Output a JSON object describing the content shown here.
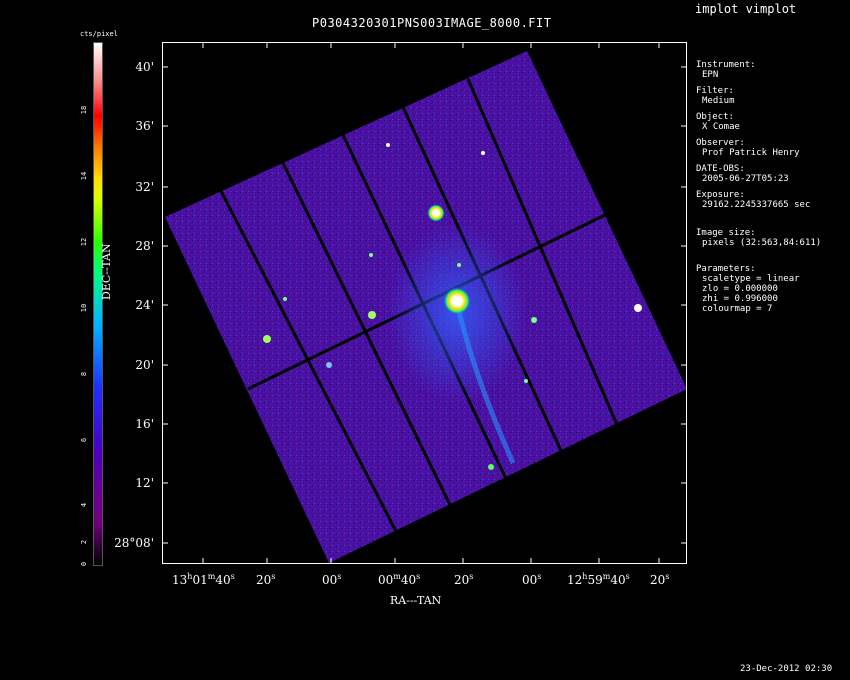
{
  "app_title": "implot vimplot",
  "plot_title": "P0304320301PNS003IMAGE_8000.FIT",
  "colorbar": {
    "label": "cts/pixel",
    "ticks": [
      "18",
      "14",
      "12",
      "10",
      "8",
      "6",
      "4",
      "2",
      "0"
    ]
  },
  "axes": {
    "ylabel": "DEC--TAN",
    "xlabel": "RA---TAN",
    "dec_ticks": [
      "40'",
      "36'",
      "32'",
      "28'",
      "24'",
      "20'",
      "16'",
      "12'",
      "28°08'"
    ],
    "ra_ticks": [
      "13h01m40s",
      "20s",
      "00s",
      "00m40s",
      "20s",
      "00s",
      "12h59m40s",
      "20s"
    ]
  },
  "info": {
    "instrument_label": "Instrument:",
    "instrument_value": "EPN",
    "filter_label": "Filter:",
    "filter_value": "Medium",
    "object_label": "Object:",
    "object_value": "X Comae",
    "observer_label": "Observer:",
    "observer_value": "Prof Patrick Henry",
    "date_label": "DATE-OBS:",
    "date_value": "2005-06-27T05:23",
    "exposure_label": "Exposure:",
    "exposure_value": "29162.2245337665 sec",
    "size_label": "Image size:",
    "size_value": "pixels (32:563,84:611)",
    "params_label": "Parameters:",
    "scaletype": "scaletype = linear",
    "zlo": "zlo = 0.000000",
    "zhi": "zhi = 0.996000",
    "colourmap": "colourmap =   7"
  },
  "timestamp": "23-Dec-2012 02:30",
  "colors": {
    "background": "#000000",
    "field": "#4a10a0",
    "source": "#ffffff",
    "text": "#ffffff"
  }
}
